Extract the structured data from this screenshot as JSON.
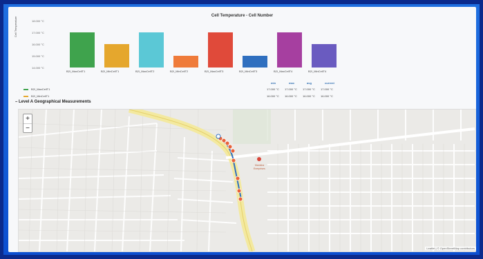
{
  "panel": {
    "chart_title": "Cell Temperature - Cell Number",
    "section_title": "– Level A Geographical Measurements",
    "legend": {
      "headers": [
        "min",
        "max",
        "avg",
        "current"
      ],
      "rows": [
        {
          "name": "B2I_MaxCellT1",
          "color": "#3fa34d",
          "min": "17.000 °C",
          "max": "17.000 °C",
          "avg": "17.000 °C",
          "current": "17.000 °C"
        },
        {
          "name": "B2I_MinCellT1",
          "color": "#e5a72d",
          "min": "16.000 °C",
          "max": "16.000 °C",
          "avg": "16.000 °C",
          "current": "16.000 °C"
        }
      ]
    },
    "map": {
      "zoom_in": "+",
      "zoom_out": "−",
      "attribution": "Leaflet | © OpenStreetMap contributors",
      "poi_label": "Manisha\nEnerprises"
    }
  },
  "chart_data": {
    "type": "bar",
    "title": "Cell Temperature - Cell Number",
    "ylabel": "Cell Temperature",
    "ylim": [
      14.0,
      18.0
    ],
    "yticks": [
      "18.000 °C",
      "17.000 °C",
      "16.000 °C",
      "15.000 °C",
      "14.000 °C"
    ],
    "categories": [
      "B2I_MaxCellT1",
      "B2I_MinCellT1",
      "B2I_MaxCellT2",
      "B2I_MinCellT2",
      "B2I_MaxCellT3",
      "B2I_MinCellT3",
      "B2I_MaxCellT4",
      "B2I_MinCellT4"
    ],
    "values": [
      17.0,
      16.0,
      17.0,
      15.0,
      17.0,
      15.0,
      17.0,
      16.0
    ],
    "colors": [
      "#3fa34d",
      "#e5a72d",
      "#5bc8d6",
      "#ef7b3a",
      "#e04a3a",
      "#2f6fbf",
      "#a63fa0",
      "#6a5bc0"
    ]
  }
}
